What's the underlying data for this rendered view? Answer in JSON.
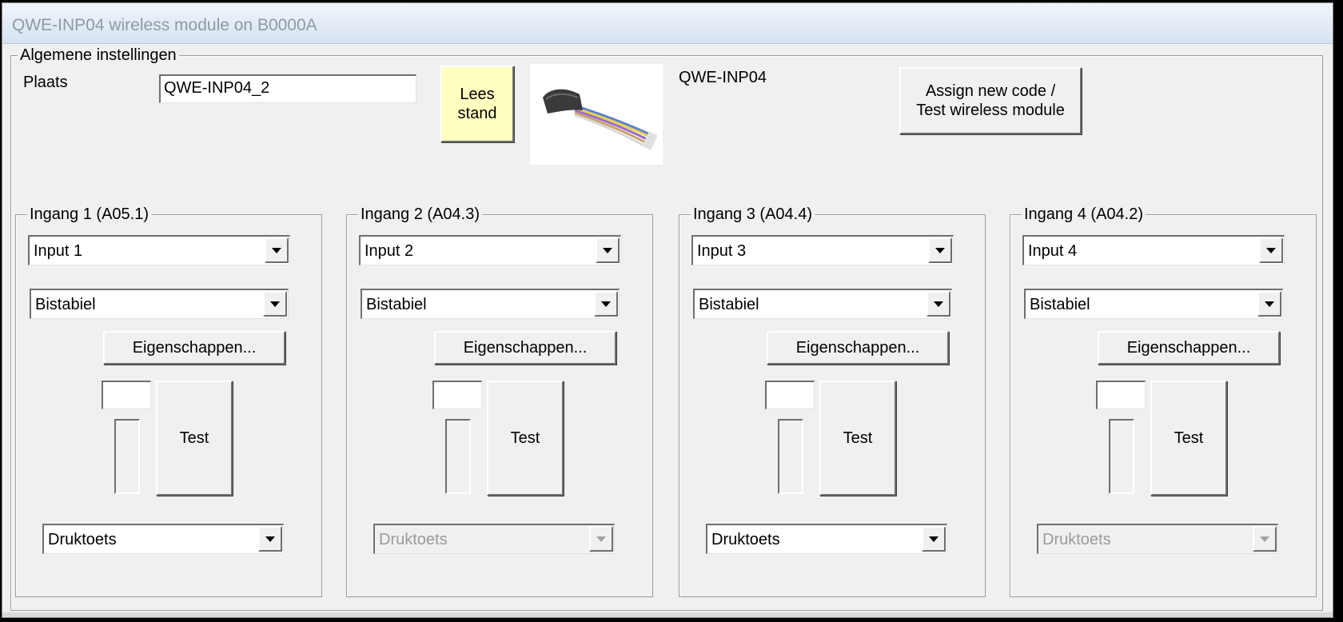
{
  "window": {
    "title": "QWE-INP04 wireless module on B0000A"
  },
  "general": {
    "legend": "Algemene instellingen",
    "location_label": "Plaats",
    "location_value": "QWE-INP04_2",
    "read_button_label": "Lees\nstand",
    "module_name": "QWE-INP04",
    "assign_button_label": "Assign new code /\nTest wireless module"
  },
  "inputs": [
    {
      "legend": "Ingang 1 (A05.1)",
      "name": "Input 1",
      "mode": "Bistabiel",
      "properties_label": "Eigenschappen...",
      "counter_value": "",
      "test_label": "Test",
      "type": "Druktoets",
      "type_enabled": true
    },
    {
      "legend": "Ingang 2 (A04.3)",
      "name": "Input 2",
      "mode": "Bistabiel",
      "properties_label": "Eigenschappen...",
      "counter_value": "",
      "test_label": "Test",
      "type": "Druktoets",
      "type_enabled": false
    },
    {
      "legend": "Ingang 3 (A04.4)",
      "name": "Input 3",
      "mode": "Bistabiel",
      "properties_label": "Eigenschappen...",
      "counter_value": "",
      "test_label": "Test",
      "type": "Druktoets",
      "type_enabled": true
    },
    {
      "legend": "Ingang 4 (A04.2)",
      "name": "Input 4",
      "mode": "Bistabiel",
      "properties_label": "Eigenschappen...",
      "counter_value": "",
      "test_label": "Test",
      "type": "Druktoets",
      "type_enabled": false
    }
  ]
}
